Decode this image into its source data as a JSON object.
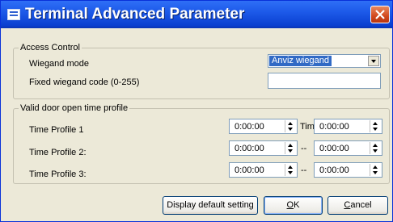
{
  "window": {
    "title": "Terminal Advanced Parameter"
  },
  "access_control": {
    "title": "Access Control",
    "wiegand_mode_label": "Wiegand mode",
    "wiegand_mode_value": "Anviz wiegand",
    "fixed_code_label": "Fixed wiegand code (0-255)",
    "fixed_code_value": ""
  },
  "door_profile": {
    "title": "Valid door open time profile",
    "rows": [
      {
        "label": "Time Profile 1",
        "start": "0:00:00",
        "sep": "Tim",
        "end": "0:00:00"
      },
      {
        "label": "Time Profile 2:",
        "start": "0:00:00",
        "sep": "--",
        "end": "0:00:00"
      },
      {
        "label": "Time Profile 3:",
        "start": "0:00:00",
        "sep": "--",
        "end": "0:00:00"
      }
    ]
  },
  "buttons": {
    "default_label": "Display default setting",
    "ok_mnemonic": "O",
    "ok_rest": "K",
    "cancel_mnemonic": "C",
    "cancel_rest": "ancel"
  }
}
